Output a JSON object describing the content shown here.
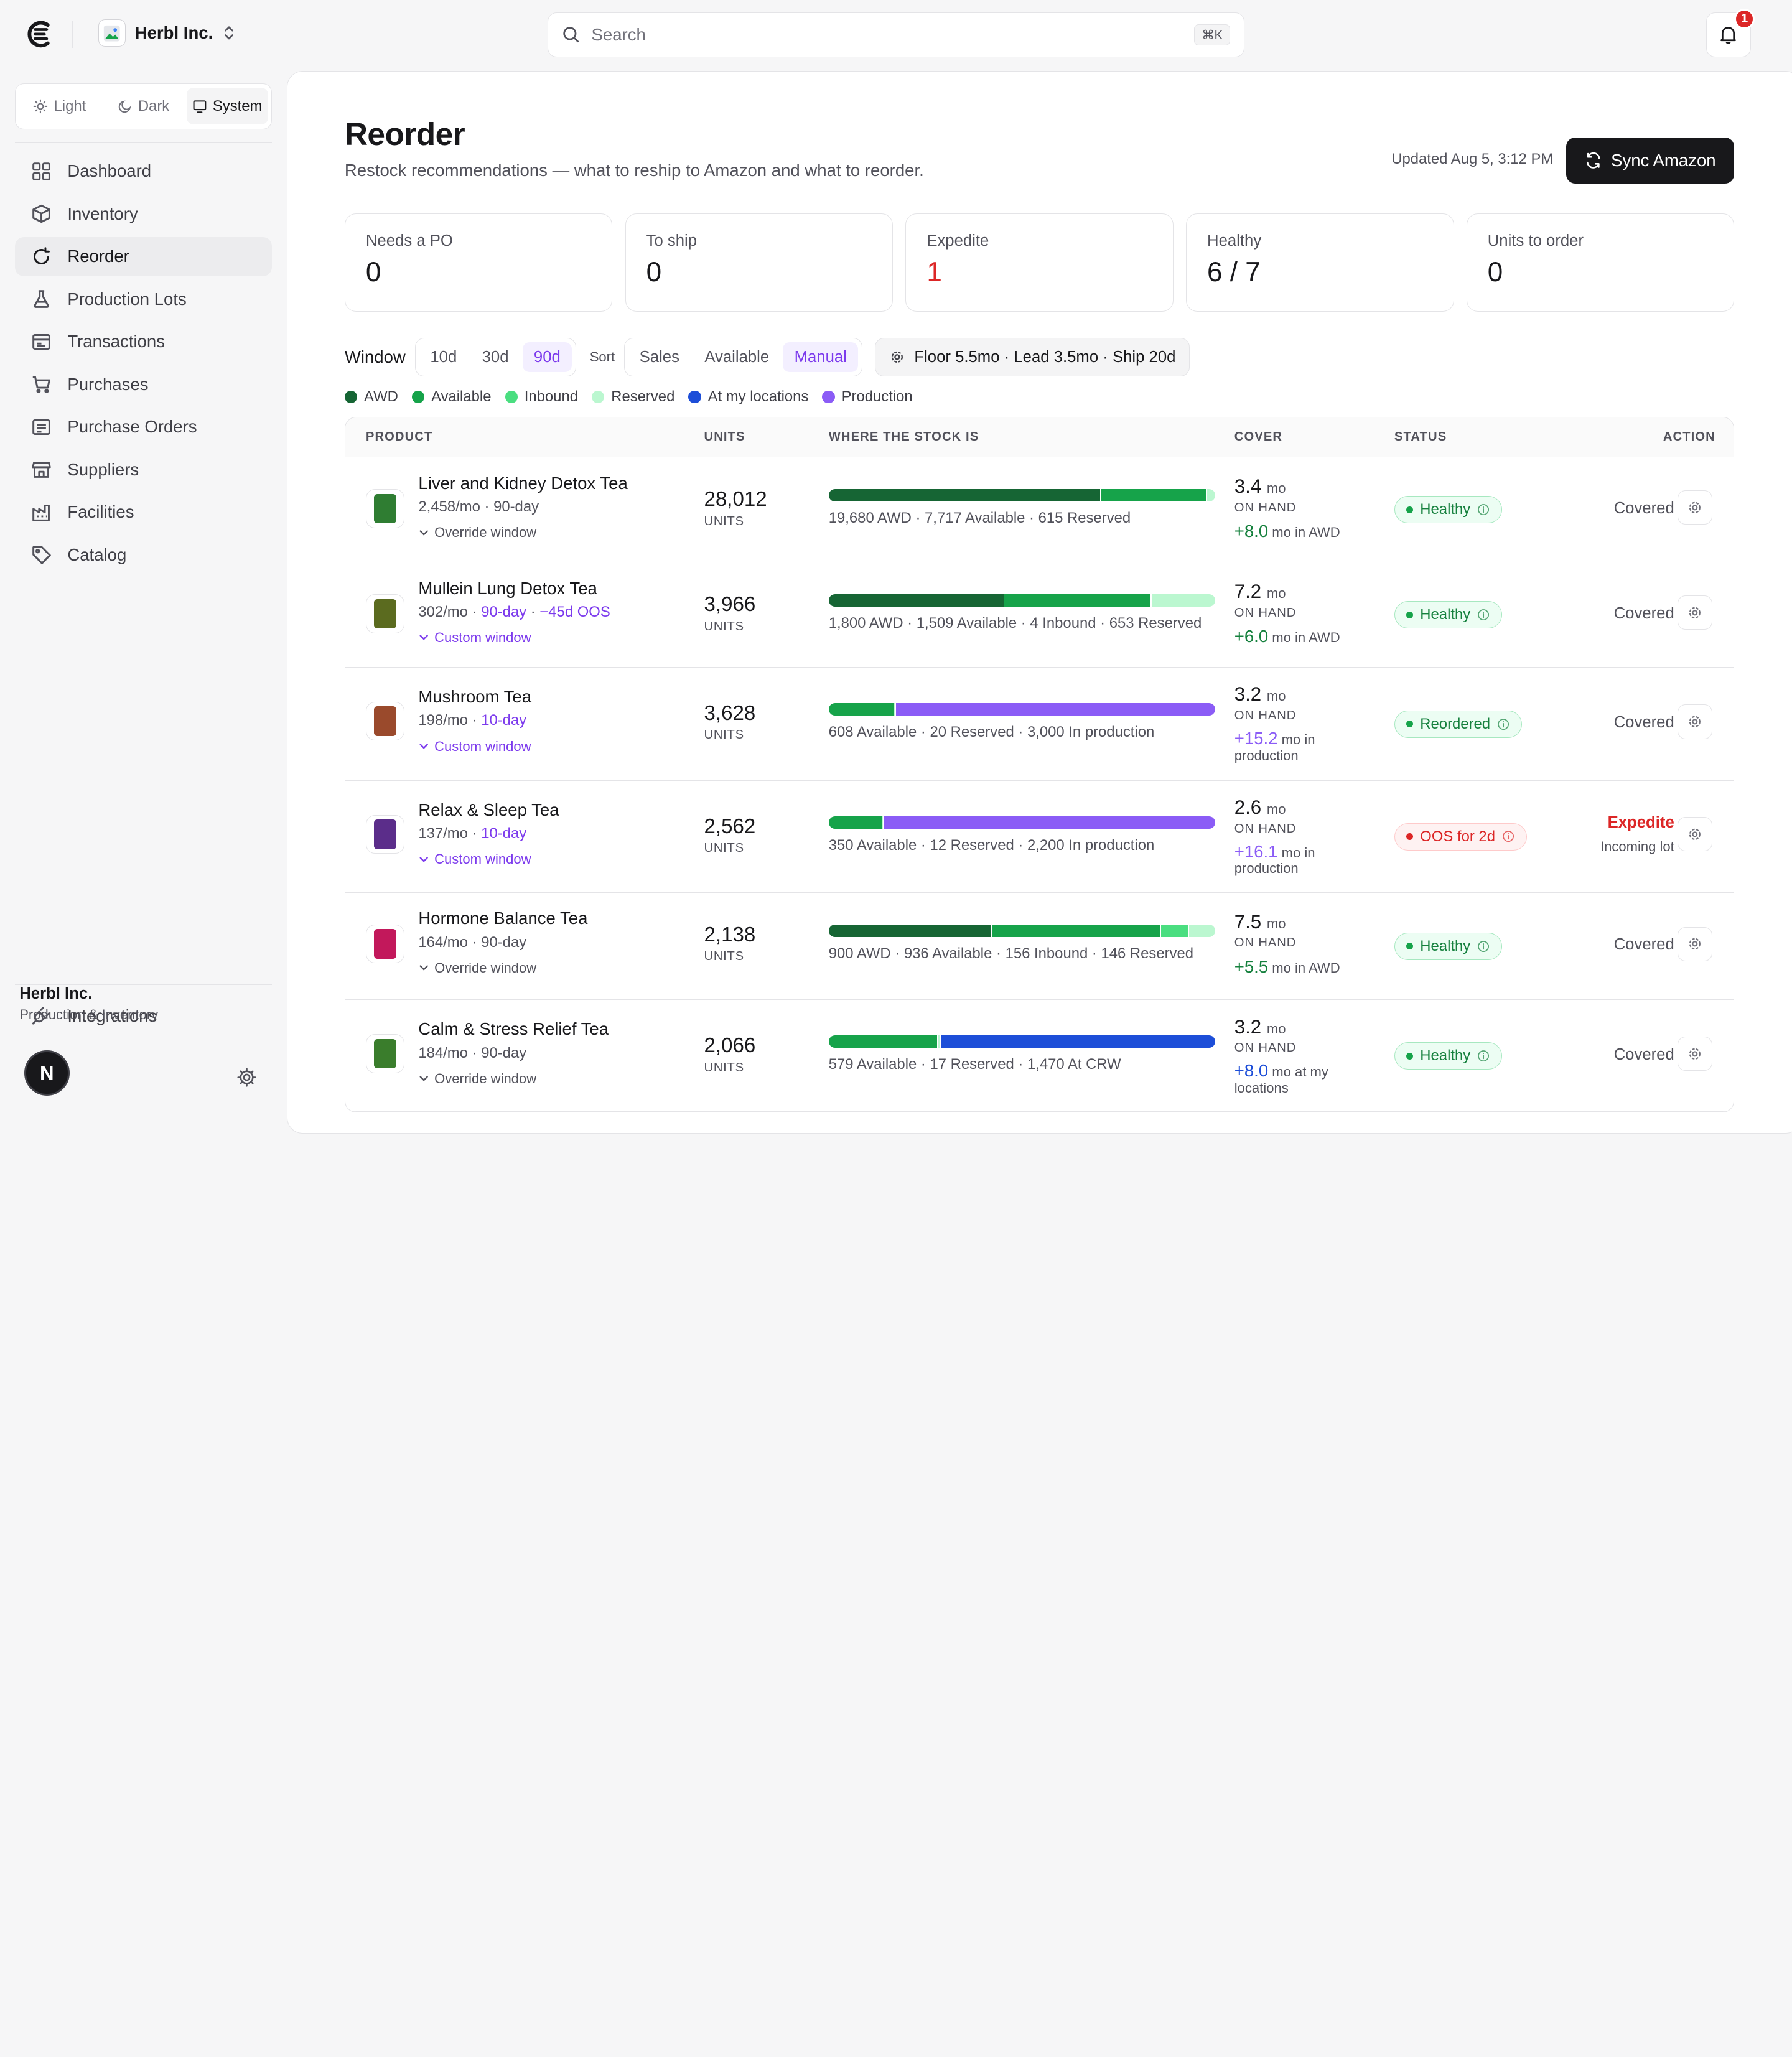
{
  "colors": {
    "awd": "#166534",
    "available": "#16a34a",
    "inbound": "#4ade80",
    "reserved": "#bbf7d0",
    "at_locations": "#1d4ed8",
    "production": "#8b5cf6",
    "expedite": "#dc2626",
    "accent": "#7c3aed"
  },
  "header": {
    "org_name": "Herbl Inc.",
    "search_placeholder": "Search",
    "search_shortcut": "⌘K",
    "notification_count": "1"
  },
  "sidebar": {
    "theme": [
      {
        "label": "Light",
        "icon": "sun-icon",
        "active": false
      },
      {
        "label": "Dark",
        "icon": "moon-icon",
        "active": false
      },
      {
        "label": "System",
        "icon": "monitor-icon",
        "active": true
      }
    ],
    "items": [
      {
        "label": "Dashboard",
        "icon": "grid-icon",
        "active": false
      },
      {
        "label": "Inventory",
        "icon": "box-icon",
        "active": false
      },
      {
        "label": "Reorder",
        "icon": "refresh-icon",
        "active": true
      },
      {
        "label": "Production Lots",
        "icon": "flask-icon",
        "active": false
      },
      {
        "label": "Transactions",
        "icon": "receipt-icon",
        "active": false
      },
      {
        "label": "Purchases",
        "icon": "cart-icon",
        "active": false
      },
      {
        "label": "Purchase Orders",
        "icon": "clipboard-icon",
        "active": false
      },
      {
        "label": "Suppliers",
        "icon": "store-icon",
        "active": false
      },
      {
        "label": "Facilities",
        "icon": "factory-icon",
        "active": false
      },
      {
        "label": "Catalog",
        "icon": "tag-icon",
        "active": false
      }
    ],
    "integrations_label": "Integrations",
    "user_name": "Herbl Inc.",
    "user_role": "Production & Inventory",
    "user_initial": "N"
  },
  "page": {
    "title": "Reorder",
    "subtitle": "Restock recommendations — what to reship to Amazon and what to reorder.",
    "updated": "Updated Aug 5, 3:12 PM",
    "sync_label": "Sync Amazon"
  },
  "stats": [
    {
      "label": "Needs a PO",
      "value": "0",
      "red": false
    },
    {
      "label": "To ship",
      "value": "0",
      "red": false
    },
    {
      "label": "Expedite",
      "value": "1",
      "red": true
    },
    {
      "label": "Healthy",
      "value": "6 / 7",
      "red": false
    },
    {
      "label": "Units to order",
      "value": "0",
      "red": false
    }
  ],
  "controls": {
    "window_label": "Window",
    "window_options": [
      "10d",
      "30d",
      "90d"
    ],
    "window_selected": "90d",
    "sort_label": "Sort",
    "sort_options": [
      "Sales",
      "Available",
      "Manual"
    ],
    "sort_selected": "Manual",
    "floor_label": "Floor 5.5mo · Lead 3.5mo · Ship 20d"
  },
  "legend": [
    {
      "label": "AWD",
      "color": "#166534"
    },
    {
      "label": "Available",
      "color": "#16a34a"
    },
    {
      "label": "Inbound",
      "color": "#4ade80"
    },
    {
      "label": "Reserved",
      "color": "#bbf7d0"
    },
    {
      "label": "At my locations",
      "color": "#1d4ed8"
    },
    {
      "label": "Production",
      "color": "#8b5cf6"
    }
  ],
  "table": {
    "headers": [
      "PRODUCT",
      "UNITS",
      "WHERE THE STOCK IS",
      "COVER",
      "STATUS",
      "ACTION"
    ],
    "rows": [
      {
        "name": "Liver and Kidney Detox Tea",
        "rate": "2,458/mo",
        "window": "90-day",
        "window_custom": false,
        "oos": "",
        "window_link": "Override window",
        "units": "28,012",
        "units_label": "UNITS",
        "segments": [
          {
            "kind": "awd",
            "units": 19680
          },
          {
            "kind": "available",
            "units": 7717
          },
          {
            "kind": "reserved",
            "units": 615
          }
        ],
        "stock_note": "19,680 AWD · 7,717 Available · 615 Reserved",
        "cover_value": "3.4",
        "cover_unit": "mo",
        "on_hand_label": "ON HAND",
        "extra_value": "+8.0",
        "extra_label": "mo in AWD",
        "extra_kind": "awd",
        "status": "Healthy",
        "status_kind": "green",
        "action": "Covered",
        "action_sub": "",
        "bag_color": "#2f7d32"
      },
      {
        "name": "Mullein Lung Detox Tea",
        "rate": "302/mo",
        "window": "90-day",
        "window_custom": true,
        "oos": "−45d OOS",
        "window_link": "Custom window",
        "units": "3,966",
        "units_label": "UNITS",
        "segments": [
          {
            "kind": "awd",
            "units": 1800
          },
          {
            "kind": "available",
            "units": 1509
          },
          {
            "kind": "inbound",
            "units": 4
          },
          {
            "kind": "reserved",
            "units": 653
          }
        ],
        "stock_note": "1,800 AWD · 1,509 Available · 4 Inbound · 653 Reserved",
        "cover_value": "7.2",
        "cover_unit": "mo",
        "on_hand_label": "ON HAND",
        "extra_value": "+6.0",
        "extra_label": "mo in AWD",
        "extra_kind": "awd",
        "status": "Healthy",
        "status_kind": "green",
        "action": "Covered",
        "action_sub": "",
        "bag_color": "#5b6b1f"
      },
      {
        "name": "Mushroom Tea",
        "rate": "198/mo",
        "window": "10-day",
        "window_custom": true,
        "oos": "",
        "window_link": "Custom window",
        "units": "3,628",
        "units_label": "UNITS",
        "segments": [
          {
            "kind": "available",
            "units": 608
          },
          {
            "kind": "reserved",
            "units": 20
          },
          {
            "kind": "production",
            "units": 3000
          }
        ],
        "stock_note": "608 Available · 20 Reserved · 3,000 In production",
        "cover_value": "3.2",
        "cover_unit": "mo",
        "on_hand_label": "ON HAND",
        "extra_value": "+15.2",
        "extra_label": "mo in production",
        "extra_kind": "production",
        "status": "Reordered",
        "status_kind": "green",
        "action": "Covered",
        "action_sub": "",
        "bag_color": "#9a4a2c"
      },
      {
        "name": "Relax & Sleep Tea",
        "rate": "137/mo",
        "window": "10-day",
        "window_custom": true,
        "oos": "",
        "window_link": "Custom window",
        "units": "2,562",
        "units_label": "UNITS",
        "segments": [
          {
            "kind": "available",
            "units": 350
          },
          {
            "kind": "reserved",
            "units": 12
          },
          {
            "kind": "production",
            "units": 2200
          }
        ],
        "stock_note": "350 Available · 12 Reserved · 2,200 In production",
        "cover_value": "2.6",
        "cover_unit": "mo",
        "on_hand_label": "ON HAND",
        "extra_value": "+16.1",
        "extra_label": "mo in production",
        "extra_kind": "production",
        "status": "OOS for 2d",
        "status_kind": "red",
        "action": "Expedite",
        "action_sub": "Incoming lot",
        "bag_color": "#5b2d8a"
      },
      {
        "name": "Hormone Balance Tea",
        "rate": "164/mo",
        "window": "90-day",
        "window_custom": false,
        "oos": "",
        "window_link": "Override window",
        "units": "2,138",
        "units_label": "UNITS",
        "segments": [
          {
            "kind": "awd",
            "units": 900
          },
          {
            "kind": "available",
            "units": 936
          },
          {
            "kind": "inbound",
            "units": 156
          },
          {
            "kind": "reserved",
            "units": 146
          }
        ],
        "stock_note": "900 AWD · 936 Available · 156 Inbound · 146 Reserved",
        "cover_value": "7.5",
        "cover_unit": "mo",
        "on_hand_label": "ON HAND",
        "extra_value": "+5.5",
        "extra_label": "mo in AWD",
        "extra_kind": "awd",
        "status": "Healthy",
        "status_kind": "green",
        "action": "Covered",
        "action_sub": "",
        "bag_color": "#c2185b"
      },
      {
        "name": "Calm & Stress Relief Tea",
        "rate": "184/mo",
        "window": "90-day",
        "window_custom": false,
        "oos": "",
        "window_link": "Override window",
        "units": "2,066",
        "units_label": "UNITS",
        "segments": [
          {
            "kind": "available",
            "units": 579
          },
          {
            "kind": "reserved",
            "units": 17
          },
          {
            "kind": "at_locations",
            "units": 1470
          }
        ],
        "stock_note": "579 Available · 17 Reserved · 1,470 At CRW",
        "cover_value": "3.2",
        "cover_unit": "mo",
        "on_hand_label": "ON HAND",
        "extra_value": "+8.0",
        "extra_label": "mo at my locations",
        "extra_kind": "at_locations",
        "status": "Healthy",
        "status_kind": "green",
        "action": "Covered",
        "action_sub": "",
        "bag_color": "#3a7d2c"
      }
    ]
  }
}
